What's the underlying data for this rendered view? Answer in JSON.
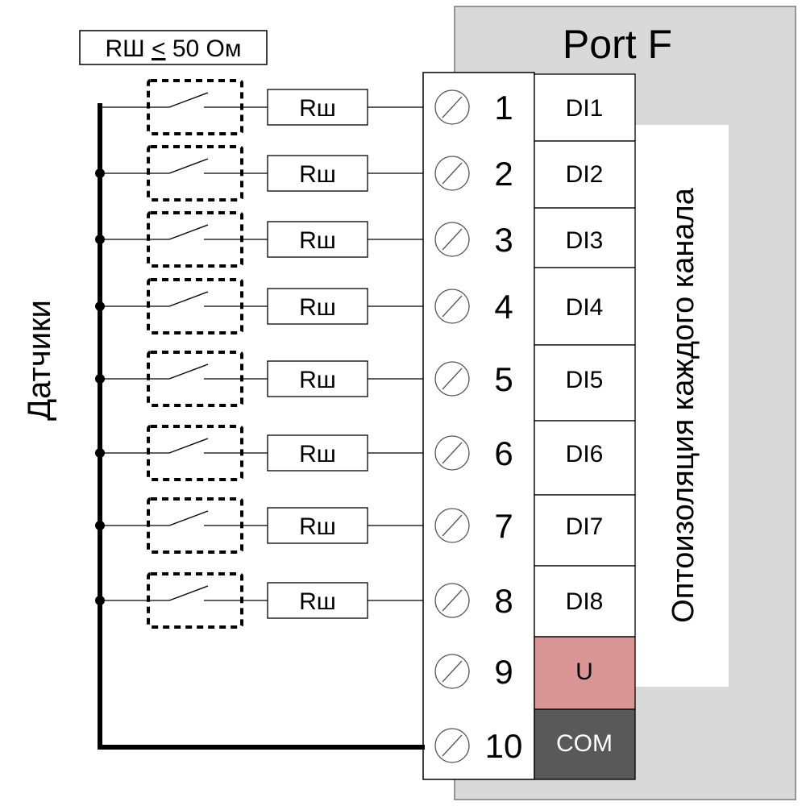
{
  "port_title": "Port F",
  "resistance_note": {
    "prefix": "RШ ",
    "le": "<",
    "suffix": " 50 Ом"
  },
  "sensors_label": "Датчики",
  "isolation_label": "Оптоизоляция каждого канала",
  "resistor_label": "Rш",
  "channels": [
    {
      "terminal": "1",
      "input": "DI1"
    },
    {
      "terminal": "2",
      "input": "DI2"
    },
    {
      "terminal": "3",
      "input": "DI3"
    },
    {
      "terminal": "4",
      "input": "DI4"
    },
    {
      "terminal": "5",
      "input": "DI5"
    },
    {
      "terminal": "6",
      "input": "DI6"
    },
    {
      "terminal": "7",
      "input": "DI7"
    },
    {
      "terminal": "8",
      "input": "DI8"
    }
  ],
  "power_terminal": {
    "terminal": "9",
    "label": "U",
    "color": "#d99694"
  },
  "common_terminal": {
    "terminal": "10",
    "label": "COM",
    "color": "#595959"
  },
  "colors": {
    "port_background": "#d9d9d9"
  }
}
